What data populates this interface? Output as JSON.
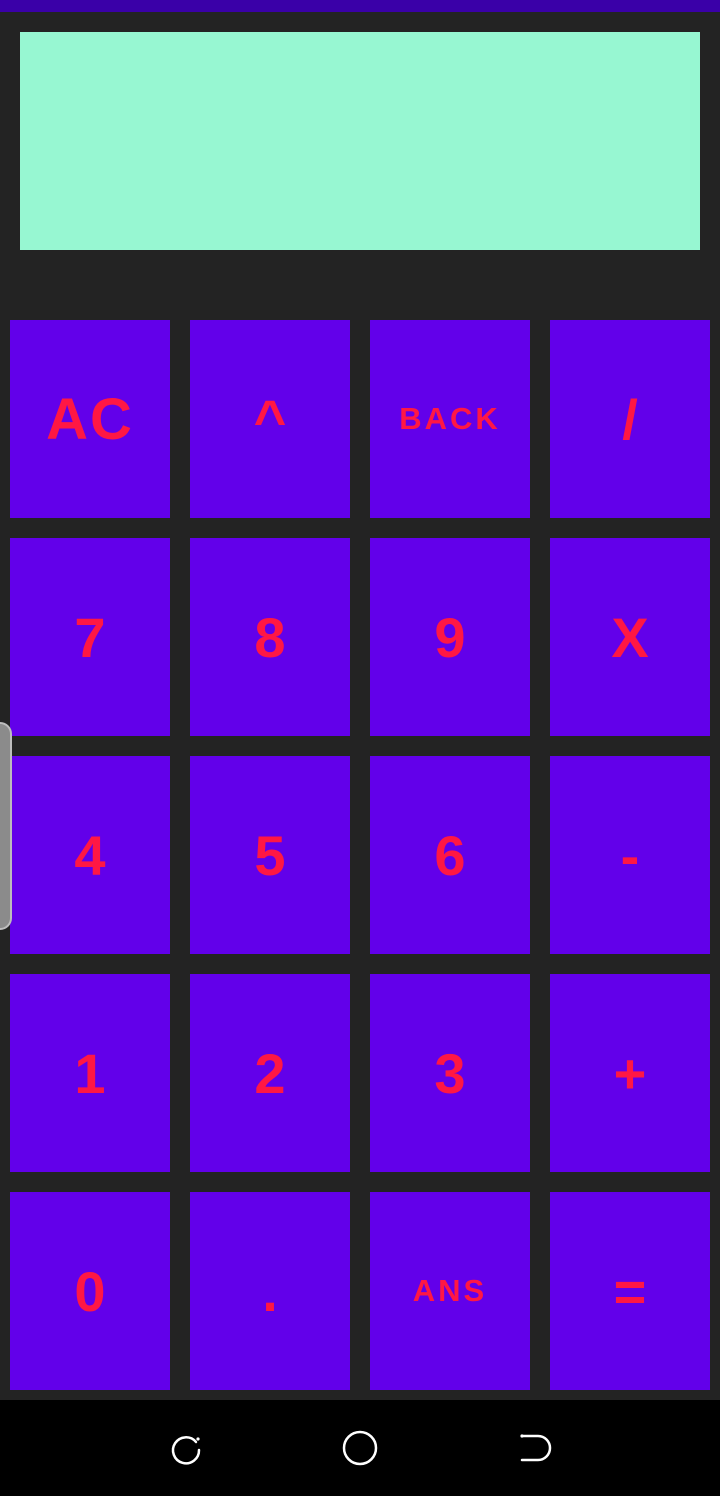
{
  "display": {
    "expression": ""
  },
  "keypad": {
    "rows": [
      [
        "AC",
        "^",
        "BACK",
        "/"
      ],
      [
        "7",
        "8",
        "9",
        "X"
      ],
      [
        "4",
        "5",
        "6",
        "-"
      ],
      [
        "1",
        "2",
        "3",
        "+"
      ],
      [
        "0",
        ".",
        "ANS",
        "="
      ]
    ]
  },
  "colors": {
    "status_bar": "#3a00a8",
    "background": "#232323",
    "display": "#97f7d2",
    "key": "#6200ea",
    "key_text": "#ff1744",
    "nav_bar": "#000000"
  },
  "navigation": {
    "icons": [
      "recents-icon",
      "home-icon",
      "back-icon"
    ]
  }
}
